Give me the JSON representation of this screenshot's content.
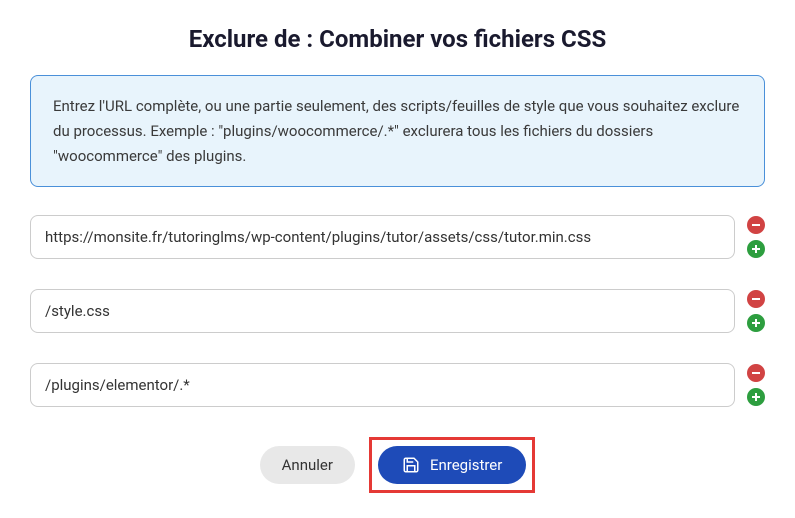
{
  "title": "Exclure de : Combiner vos fichiers CSS",
  "info_text": "Entrez l'URL complète, ou une partie seulement, des scripts/feuilles de style que vous souhaitez exclure du processus. Exemple : \"plugins/woocommerce/.*\" exclurera tous les fichiers du dossiers \"woocommerce\" des plugins.",
  "inputs": [
    {
      "value": "https://monsite.fr/tutoringlms/wp-content/plugins/tutor/assets/css/tutor.min.css"
    },
    {
      "value": "/style.css"
    },
    {
      "value": "/plugins/elementor/.*"
    }
  ],
  "buttons": {
    "cancel": "Annuler",
    "save": "Enregistrer"
  }
}
